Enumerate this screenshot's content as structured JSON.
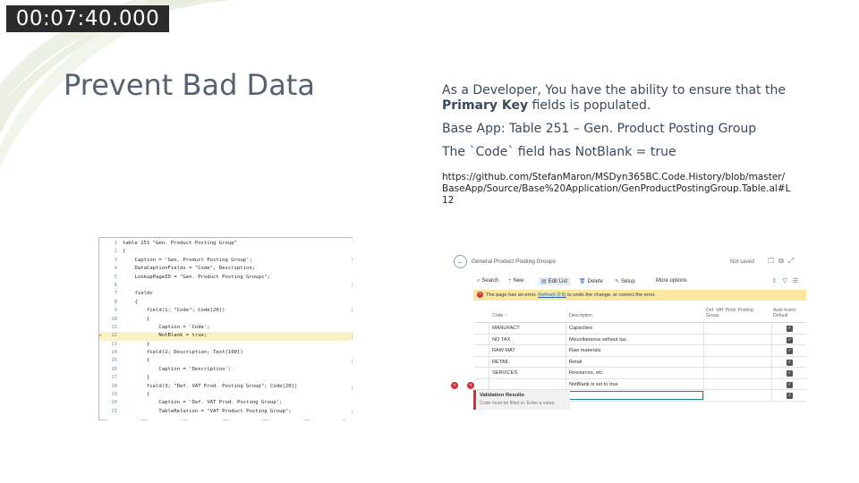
{
  "timecode": "00:07:40.000",
  "slide": {
    "title": "Prevent Bad Data",
    "bullet1_pre": "As a Developer, You have the ability to ensure that the ",
    "bullet1_bold": "Primary Key",
    "bullet1_post": " fields is populated.",
    "bullet2": "Base App: Table 251 – Gen. Product Posting Group",
    "bullet3": "The `Code` field has NotBlank = true",
    "url": "https://github.com/StefanMaron/MSDyn365BC.Code.History/blob/master/BaseApp/Source/Base%20Application/GenProductPostingGroup.Table.al#L12"
  },
  "code": {
    "lines": [
      {
        "n": "1",
        "t": "table 251 \"Gen. Product Posting Group\""
      },
      {
        "n": "2",
        "t": "{"
      },
      {
        "n": "3",
        "t": "    Caption = 'Gen. Product Posting Group';"
      },
      {
        "n": "4",
        "t": "    DataCaptionFields = \"Code\", Description;"
      },
      {
        "n": "5",
        "t": "    LookupPageID = \"Gen. Product Posting Groups\";"
      },
      {
        "n": "6",
        "t": ""
      },
      {
        "n": "7",
        "t": "    fields"
      },
      {
        "n": "8",
        "t": "    {"
      },
      {
        "n": "9",
        "t": "        field(1; \"Code\"; Code[20])"
      },
      {
        "n": "10",
        "t": "        {"
      },
      {
        "n": "11",
        "t": "            Caption = 'Code';"
      },
      {
        "n": "12",
        "t": "            NotBlank = true;"
      },
      {
        "n": "13",
        "t": "        }"
      },
      {
        "n": "14",
        "t": "        field(2; Description; Text[100])"
      },
      {
        "n": "15",
        "t": "        {"
      },
      {
        "n": "16",
        "t": "            Caption = 'Description';"
      },
      {
        "n": "17",
        "t": "        }"
      },
      {
        "n": "18",
        "t": "        field(3; \"Def. VAT Prod. Posting Group\"; Code[20])"
      },
      {
        "n": "19",
        "t": "        {"
      },
      {
        "n": "20",
        "t": "            Caption = 'Def. VAT Prod. Posting Group';"
      },
      {
        "n": "21",
        "t": "            TableRelation = \"VAT Product Posting Group\";"
      }
    ]
  },
  "bc": {
    "page_title": "General Product Posting Groups",
    "not_saved": "Not saved",
    "actions": {
      "search": "Search",
      "new": "New",
      "edit_list": "Edit List",
      "delete": "Delete",
      "setup": "Setup",
      "more": "More options"
    },
    "error_pre": "The page has an error. ",
    "error_link": "Refresh (F5)",
    "error_post": " to undo the change, or correct the error.",
    "headers": {
      "code": "Code ↑",
      "description": "Description",
      "def_vat": "Def. VAT Prod. Posting Group",
      "auto_insert": "Auto Insert Default"
    },
    "rows": [
      {
        "code": "MANUFACT",
        "description": "Capacities"
      },
      {
        "code": "NO TAX",
        "description": "Miscellaneous without tax"
      },
      {
        "code": "RAW MAT",
        "description": "Raw materials"
      },
      {
        "code": "RETAIL",
        "description": "Retail"
      },
      {
        "code": "SERVICES",
        "description": "Resources, etc."
      },
      {
        "code": "",
        "description": "NotBlank is set to true"
      },
      {
        "code": "",
        "description": ""
      }
    ],
    "validation_title": "Validation Results",
    "validation_msg": "Code must be filled in. Enter a value."
  }
}
